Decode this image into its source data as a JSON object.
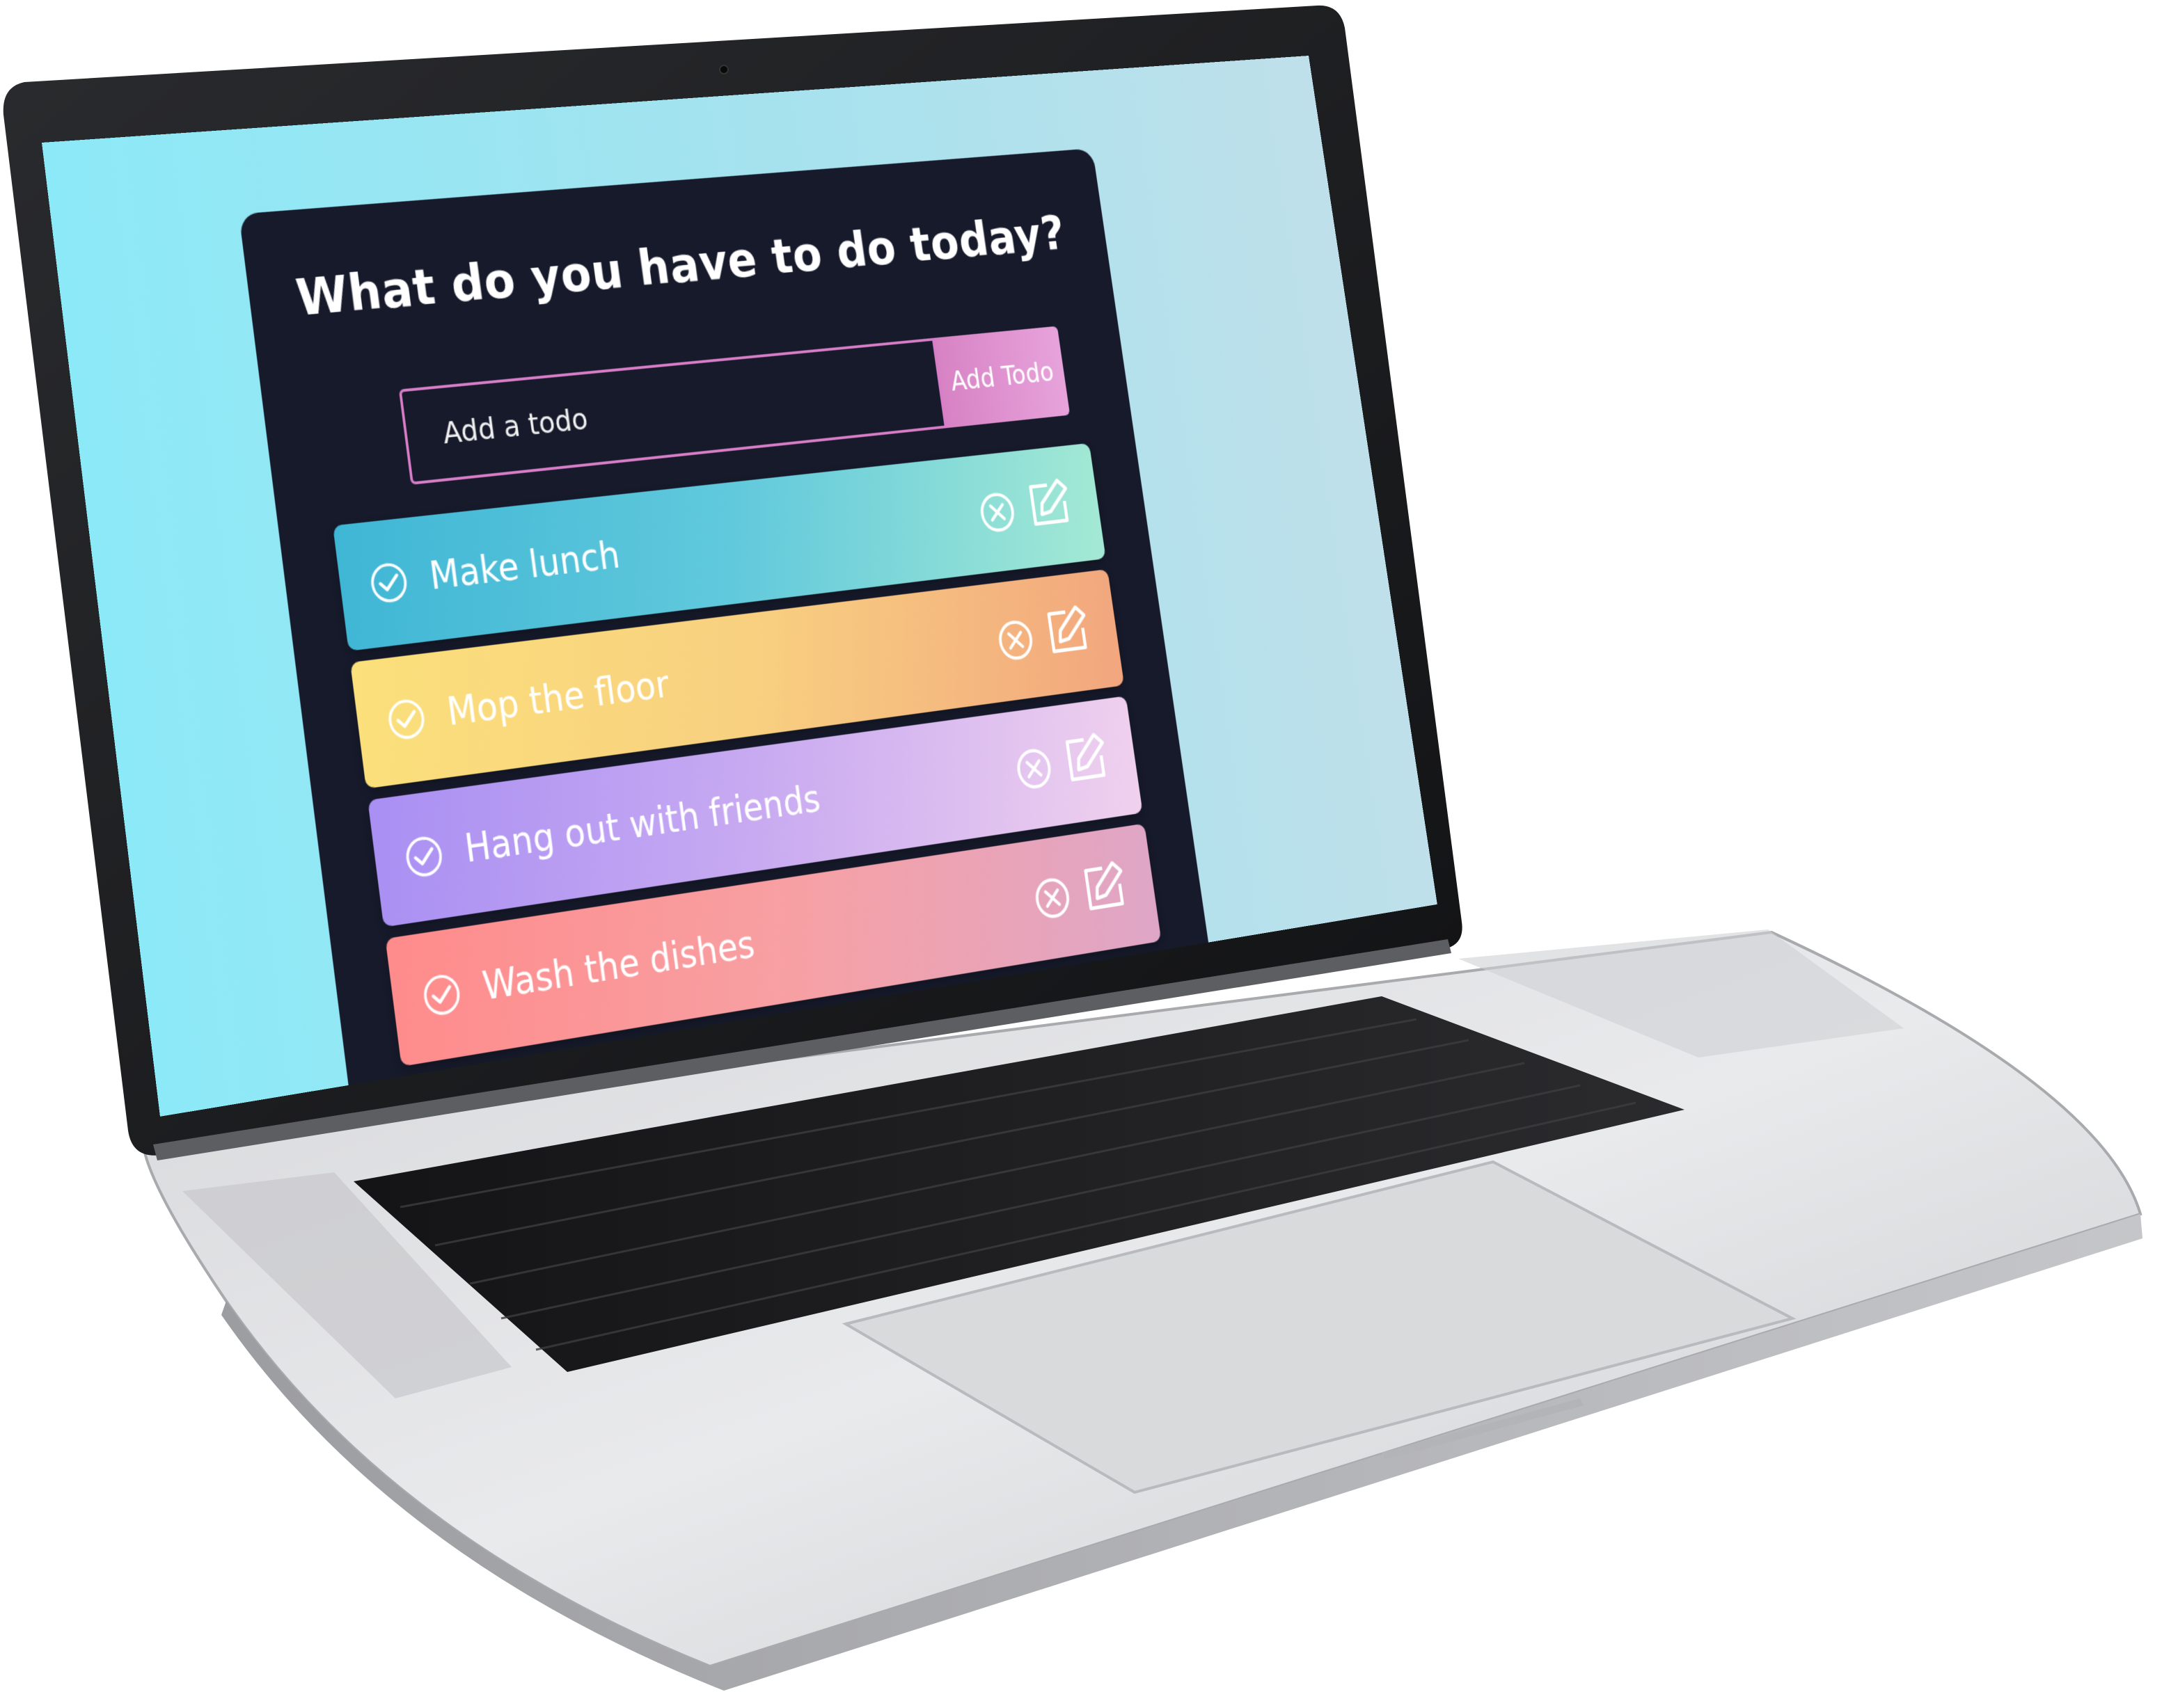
{
  "app": {
    "title": "What do you have to do today?"
  },
  "form": {
    "placeholder": "Add a todo",
    "button_label": "Add Todo"
  },
  "todos": [
    {
      "text": "Make lunch",
      "gradient": [
        "#3fb6d5",
        "#61c9dc",
        "#a4e9d4"
      ]
    },
    {
      "text": "Mop the floor",
      "gradient": [
        "#fbe07b",
        "#f8d080",
        "#f2a67e"
      ]
    },
    {
      "text": "Hang out with friends",
      "gradient": [
        "#a98ff3",
        "#c9abf1",
        "#f0d1ee"
      ]
    },
    {
      "text": "Wash the dishes",
      "gradient": [
        "#ff8b8b",
        "#f7a0a3",
        "#dea6c7"
      ]
    }
  ],
  "icons": {
    "check": "check-circle-icon",
    "delete": "close-circle-icon",
    "edit": "edit-icon"
  },
  "colors": {
    "desktop_background": "#9ee5f3",
    "app_background": "#161a2b",
    "accent": "#d87ec9"
  }
}
